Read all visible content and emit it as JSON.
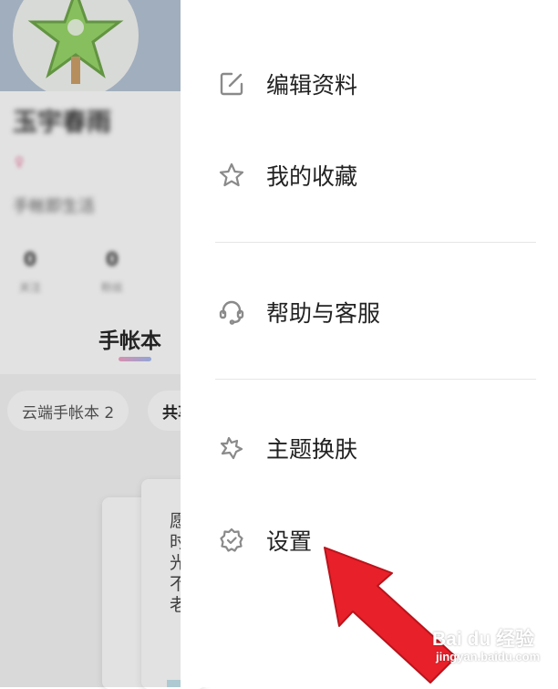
{
  "background_page": {
    "user_name": "玉宇春雨",
    "gender_symbol": "♀",
    "bio": "手帐即生活",
    "stats": [
      {
        "value": "0",
        "label": "关注"
      },
      {
        "value": "0",
        "label": "粉丝"
      }
    ],
    "active_tab": "手帐本",
    "chips": [
      "云端手帐本 2",
      "共享"
    ],
    "notebook_preview_text": "愿\n时\n光\n不\n老"
  },
  "drawer": {
    "menu_group_1": [
      {
        "label": "编辑资料",
        "icon": "edit-icon"
      },
      {
        "label": "我的收藏",
        "icon": "star-icon"
      }
    ],
    "menu_group_2": [
      {
        "label": "帮助与客服",
        "icon": "headset-icon"
      }
    ],
    "menu_group_3": [
      {
        "label": "主题换肤",
        "icon": "theme-icon"
      },
      {
        "label": "设置",
        "icon": "settings-icon"
      }
    ]
  },
  "annotation": {
    "arrow_color": "#e8202a"
  },
  "watermark": {
    "brand": "Bai du 经验",
    "domain": "jingyan.baidu.com"
  },
  "colors": {
    "icon_gray": "#8a8a8a",
    "text_dark": "#222222",
    "divider": "#e6e6e6"
  }
}
